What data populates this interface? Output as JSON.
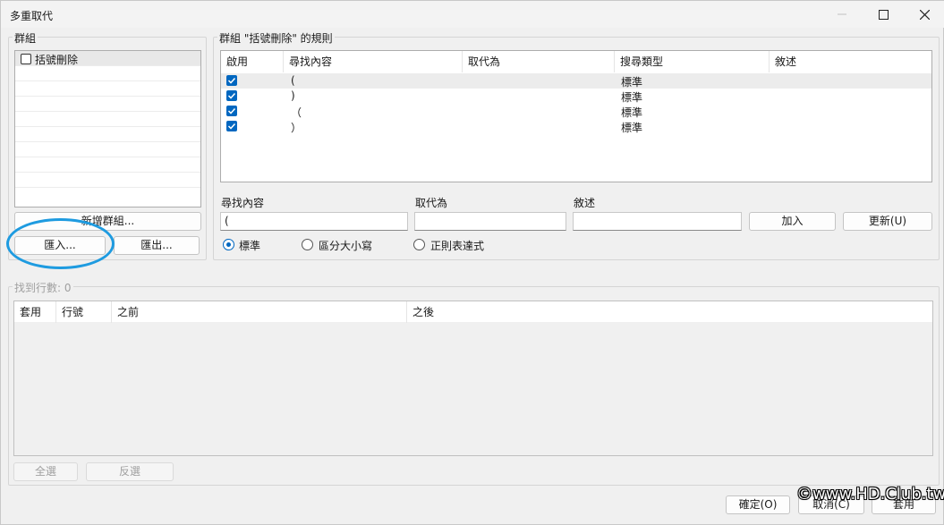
{
  "window": {
    "title": "多重取代"
  },
  "groups_panel": {
    "label": "群組",
    "items": [
      {
        "label": "括號刪除",
        "checked": false
      }
    ],
    "add_group_label": "新增群組...",
    "import_label": "匯入...",
    "export_label": "匯出..."
  },
  "rules_panel": {
    "label": "群組 \"括號刪除\" 的規則",
    "columns": [
      "啟用",
      "尋找內容",
      "取代為",
      "搜尋類型",
      "敘述"
    ],
    "rows": [
      {
        "enabled": true,
        "find": "(",
        "replace": "",
        "type": "標準",
        "desc": ""
      },
      {
        "enabled": true,
        "find": ")",
        "replace": "",
        "type": "標準",
        "desc": ""
      },
      {
        "enabled": true,
        "find": "（",
        "replace": "",
        "type": "標準",
        "desc": ""
      },
      {
        "enabled": true,
        "find": "）",
        "replace": "",
        "type": "標準",
        "desc": ""
      }
    ],
    "find_label": "尋找內容",
    "replace_label": "取代為",
    "desc_label": "敘述",
    "find_value": "(",
    "replace_value": "",
    "desc_value": "",
    "add_label": "加入",
    "update_label": "更新(U)",
    "radio_standard": "標準",
    "radio_case": "區分大小寫",
    "radio_regex": "正則表達式",
    "selected_radio": "標準"
  },
  "results_panel": {
    "label": "找到行數: 0",
    "columns": [
      "套用",
      "行號",
      "之前",
      "之後"
    ],
    "select_all_label": "全選",
    "invert_label": "反選"
  },
  "footer": {
    "ok_label": "確定(O)",
    "cancel_label": "取消(C)",
    "apply_label": "套用"
  },
  "watermark": "©www.HD.Club.tw",
  "colors": {
    "accent": "#0067c0",
    "annotation": "#1e9be0"
  }
}
